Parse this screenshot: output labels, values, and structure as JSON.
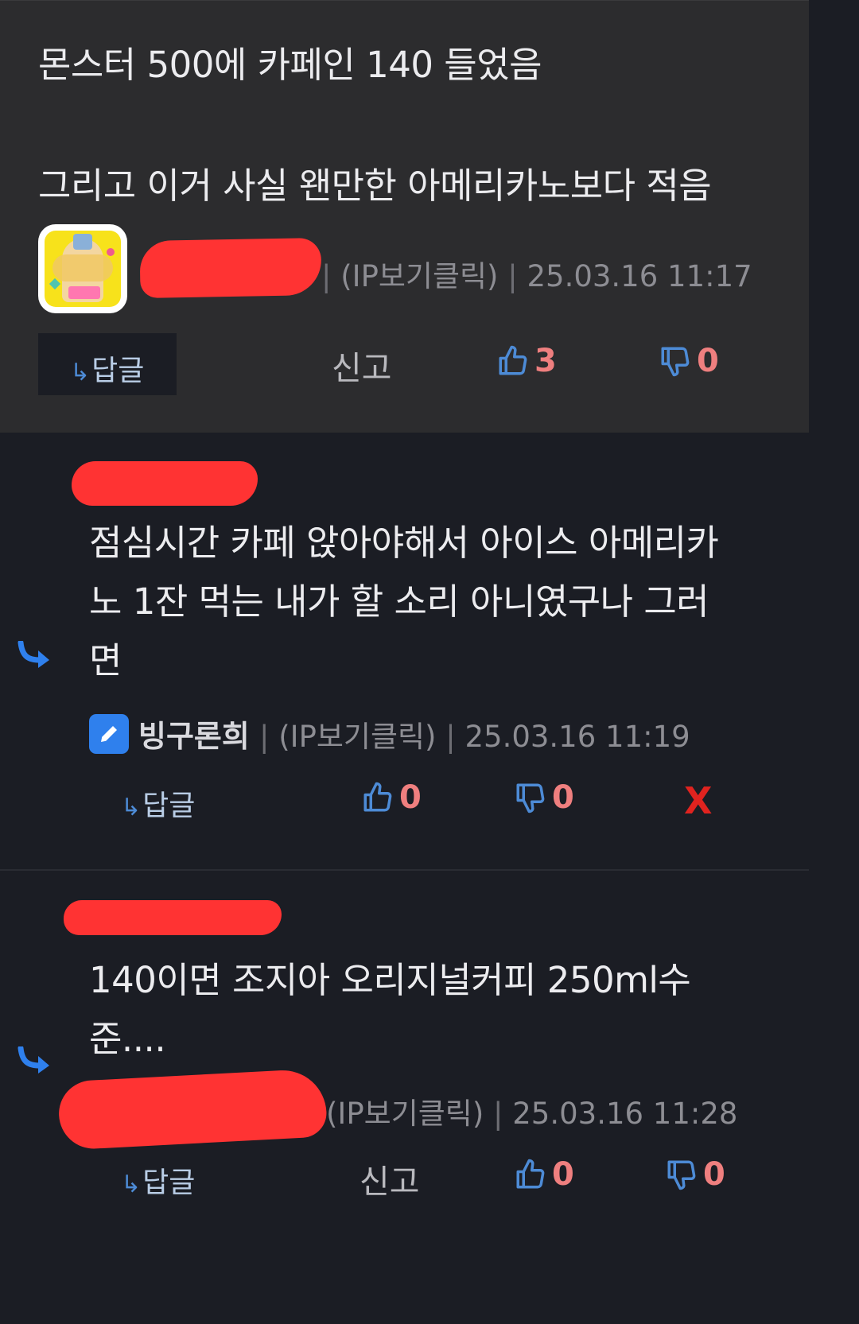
{
  "top_comment": {
    "line1": "몬스터 500에 카페인 140 들었음",
    "line2": "그리고 이거 사실 왠만한 아메리카노보다 적음",
    "ip_label": "(IP보기클릭)",
    "timestamp": "25.03.16 11:17",
    "reply_label": "답글",
    "report_label": "신고",
    "likes": "3",
    "dislikes": "0"
  },
  "reply1": {
    "text": "점심시간 카페 앉아야해서 아이스 아메리카\n노 1잔 먹는 내가 할 소리 아니였구나 그러\n면",
    "author": "빙구론희",
    "ip_label": "(IP보기클릭)",
    "timestamp": "25.03.16 11:19",
    "reply_label": "답글",
    "likes": "0",
    "dislikes": "0",
    "delete_label": "X"
  },
  "reply2": {
    "text": "140이면 조지아 오리지널커피 250ml수\n준....",
    "ip_label": "(IP보기클릭)",
    "timestamp": "25.03.16 11:28",
    "reply_label": "답글",
    "report_label": "신고",
    "likes": "0",
    "dislikes": "0"
  },
  "colors": {
    "background": "#1b1d24",
    "top_block": "#2c2c2e",
    "vote_count": "#ef7f7f",
    "thumb_icon": "#4d8bd6",
    "redaction": "#ff3333",
    "delete": "#e0231f"
  },
  "icons": [
    "reply-arrow-icon",
    "thumbs-up-icon",
    "thumbs-down-icon",
    "pencil-icon",
    "avatar-image"
  ]
}
